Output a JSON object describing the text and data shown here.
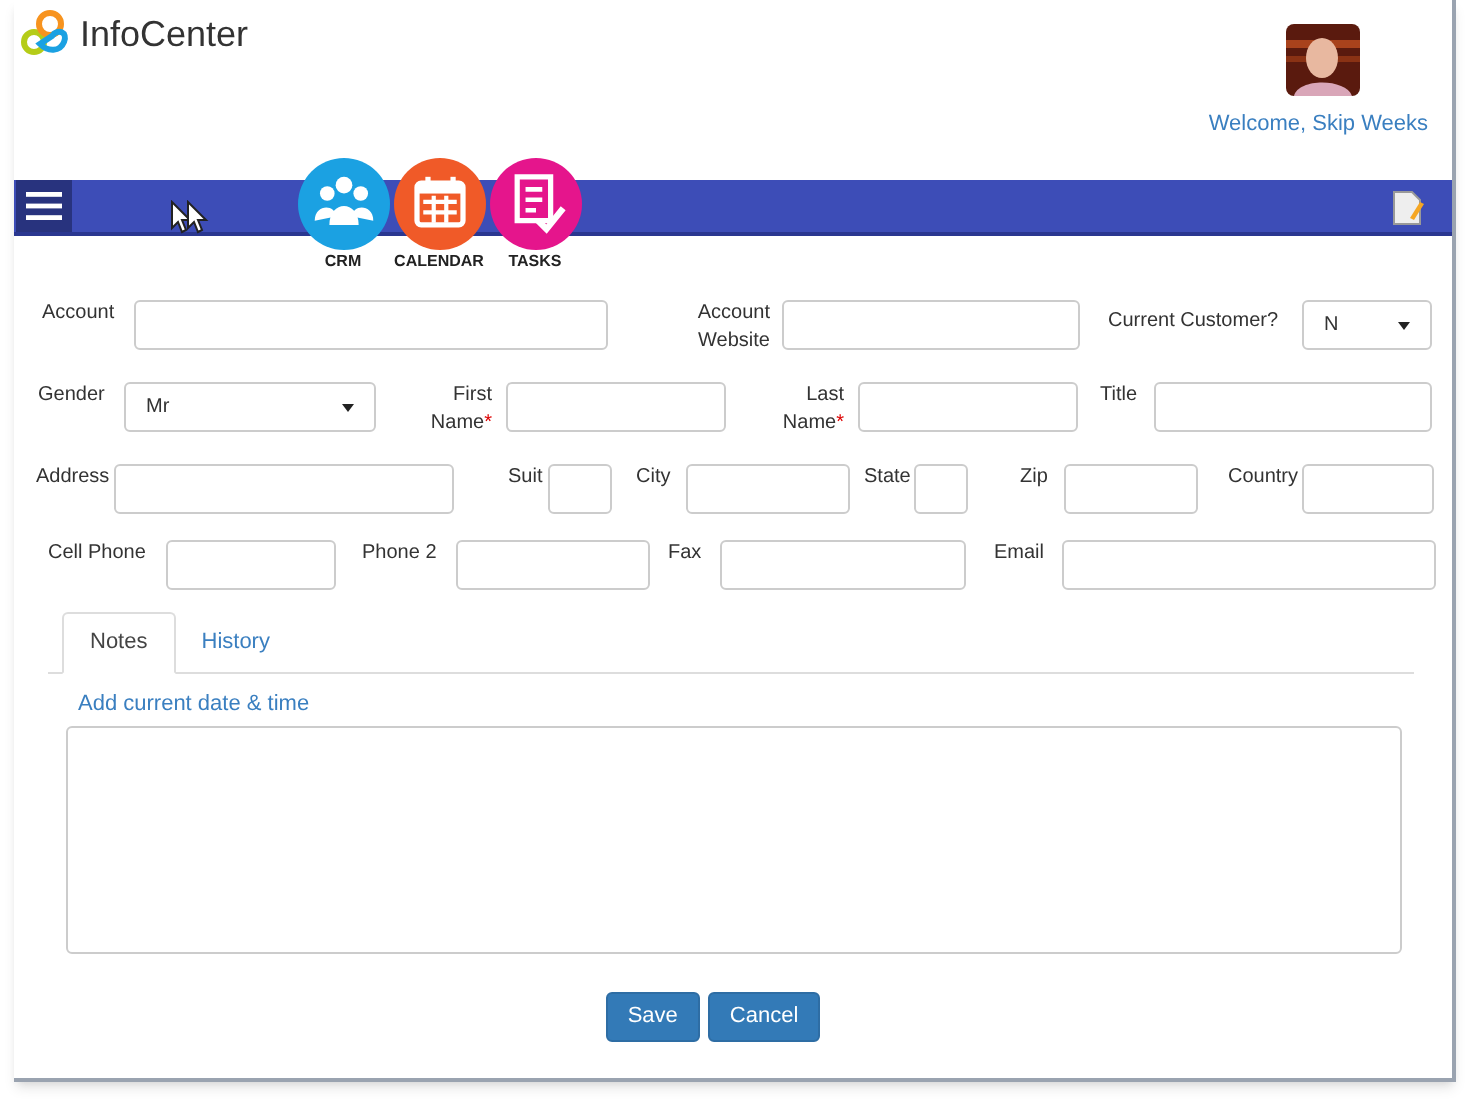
{
  "header": {
    "app_name": "InfoCenter",
    "welcome": "Welcome, Skip Weeks"
  },
  "apps": [
    {
      "label": "CRM",
      "color": "#1ba1e2",
      "kind": "people"
    },
    {
      "label": "CALENDAR",
      "color": "#f05a28",
      "kind": "calendar"
    },
    {
      "label": "TASKS",
      "color": "#e5158c",
      "kind": "tasks"
    }
  ],
  "form_rows": [
    {
      "fields": [
        {
          "label": "Account",
          "kind": "text"
        },
        {
          "label": "Account Website",
          "kind": "text"
        },
        {
          "label": "Current Customer?",
          "kind": "select",
          "value": "N"
        }
      ]
    },
    {
      "fields": [
        {
          "label": "Gender",
          "kind": "select",
          "value": "Mr"
        },
        {
          "label": "First Name",
          "kind": "text",
          "required_mark": "*"
        },
        {
          "label": "Last Name",
          "kind": "text",
          "required_mark": "*"
        },
        {
          "label": "Title",
          "kind": "text"
        }
      ]
    },
    {
      "fields": [
        {
          "label": "Address",
          "kind": "text"
        },
        {
          "label": "Suit",
          "kind": "text"
        },
        {
          "label": "City",
          "kind": "text"
        },
        {
          "label": "State",
          "kind": "text"
        },
        {
          "label": "Zip",
          "kind": "text"
        },
        {
          "label": "Country",
          "kind": "text"
        }
      ]
    },
    {
      "fields": [
        {
          "label": "Cell Phone",
          "kind": "text"
        },
        {
          "label": "Phone 2",
          "kind": "text"
        },
        {
          "label": "Fax",
          "kind": "text"
        },
        {
          "label": "Email",
          "kind": "text"
        }
      ]
    }
  ],
  "tabs": [
    {
      "label": "Notes",
      "selected": true
    },
    {
      "label": "History",
      "selected": false
    }
  ],
  "notes": {
    "link": "Add current date & time"
  },
  "buttons": [
    "Save",
    "Cancel"
  ]
}
